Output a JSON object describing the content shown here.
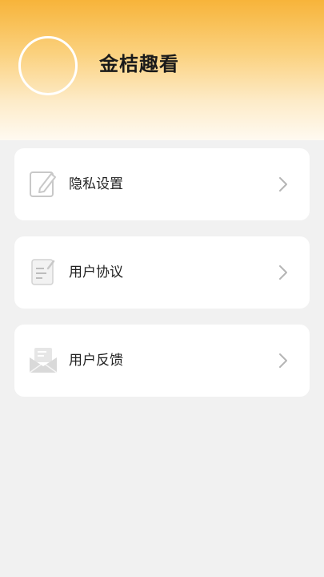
{
  "header": {
    "app_name": "金桔趣看"
  },
  "menu": {
    "items": [
      {
        "label": "隐私设置",
        "icon": "edit-icon"
      },
      {
        "label": "用户协议",
        "icon": "document-icon"
      },
      {
        "label": "用户反馈",
        "icon": "mail-icon"
      }
    ]
  }
}
